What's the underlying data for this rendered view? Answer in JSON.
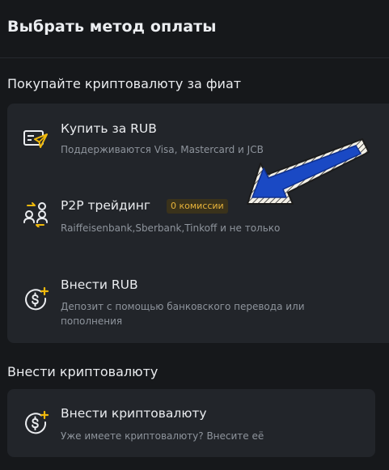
{
  "header": {
    "title": "Выбрать метод оплаты"
  },
  "fiat_section": {
    "title": "Покупайте криптовалюту за фиат",
    "options": [
      {
        "title": "Купить за RUB",
        "subtitle": "Поддерживаются Visa, Mastercard и JCB",
        "icon": "card-send-icon"
      },
      {
        "title": "P2P трейдинг",
        "badge": "0 комиссии",
        "subtitle": "Raiffeisenbank,Sberbank,Tinkoff и не только",
        "icon": "p2p-exchange-icon"
      },
      {
        "title": "Внести RUB",
        "subtitle": "Депозит с помощью банковского перевода или пополнения",
        "subtitle_lines": [
          "Депозит с помощью банковского перевода или",
          "пополнения"
        ],
        "icon": "dollar-plus-icon"
      }
    ]
  },
  "crypto_section": {
    "title": "Внести криптовалюту",
    "option": {
      "title": "Внести криптовалюту",
      "subtitle": "Уже имеете криптовалюту? Внесите её",
      "icon": "dollar-plus-icon"
    }
  },
  "colors": {
    "background": "#16181b",
    "card": "#22252a",
    "accent": "#f0b90b",
    "annotation_arrow": "#1a49c4"
  }
}
